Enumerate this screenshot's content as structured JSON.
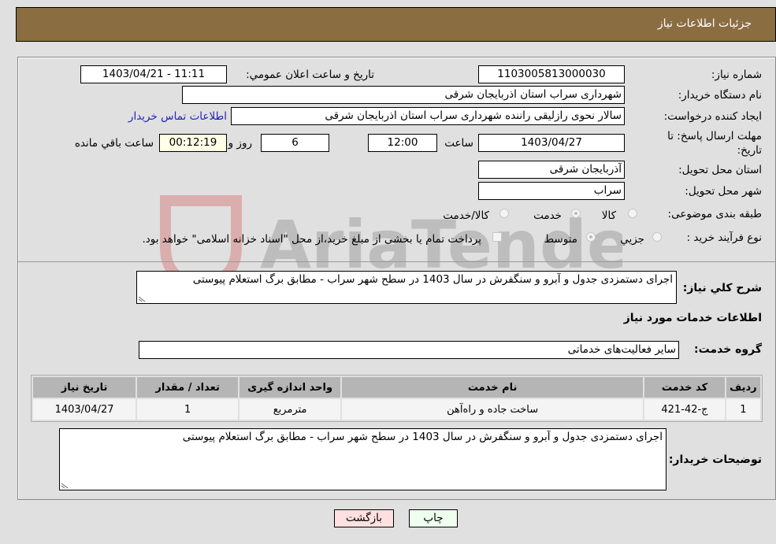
{
  "header": {
    "title": "جزئیات اطلاعات نیاز"
  },
  "form": {
    "need_number_label": "شماره نیاز:",
    "need_number": "1103005813000030",
    "announce_label": "تاریخ و ساعت اعلان عمومي:",
    "announce_value": "1403/04/21 - 11:11",
    "buyer_org_label": "نام دستگاه خریدار:",
    "buyer_org": "شهرداری سراب استان اذربایجان شرقی",
    "creator_label": "ایجاد کننده درخواست:",
    "creator": "سالار نحوی رازلیقی راننده شهرداری سراب استان اذربایجان شرقی",
    "contact_link": "اطلاعات تماس خریدار",
    "deadline_label_line1": "مهلت ارسال پاسخ: تا",
    "deadline_label_line2": "تاریخ:",
    "deadline_date": "1403/04/27",
    "time_label": "ساعت",
    "deadline_time": "12:00",
    "days": "6",
    "days_label": "روز و",
    "remaining": "00:12:19",
    "remaining_label": "ساعت باقي مانده",
    "province_label": "استان محل تحویل:",
    "province": "آذربایجان شرقی",
    "city_label": "شهر محل تحویل:",
    "city": "سراب",
    "category_label": "طبقه بندی موضوعی:",
    "category_options": [
      {
        "label": "کالا",
        "checked": false
      },
      {
        "label": "خدمت",
        "checked": true
      },
      {
        "label": "کالا/خدمت",
        "checked": false
      }
    ],
    "process_label": "نوع فرآیند خرید :",
    "process_options": [
      {
        "label": "جزيي",
        "checked": false
      },
      {
        "label": "متوسط",
        "checked": true
      }
    ],
    "payment_note": "پرداخت تمام یا بخشی از مبلغ خرید،از محل \"اسناد خزانه اسلامی\" خواهد بود.",
    "payment_checked": false
  },
  "summary": {
    "label": "شرح كلي نياز:",
    "text": "اجرای دستمزدی جدول و آبرو و سنگفرش در سال 1403 در سطح شهر سراب - مطابق برگ استعلام پیوستی"
  },
  "services": {
    "section_title": "اطلاعات خدمات مورد نیاز",
    "group_label": "گروه خدمت:",
    "group_value": "سایر فعالیت‌های خدماتی",
    "table": {
      "columns": [
        "ردیف",
        "کد خدمت",
        "نام خدمت",
        "واحد اندازه گیری",
        "تعداد / مقدار",
        "تاریخ نیاز"
      ],
      "rows": [
        [
          "1",
          "ج-42-421",
          "ساخت جاده و راه‌آهن",
          "مترمربع",
          "1",
          "1403/04/27"
        ]
      ]
    }
  },
  "buyer_notes": {
    "label": "توضیحات خریدار:",
    "text": "اجرای دستمزدی جدول و آبرو و سنگفرش در سال 1403 در سطح شهر سراب - مطابق برگ استعلام پیوستی"
  },
  "buttons": {
    "print": "چاپ",
    "back": "بازگشت"
  },
  "colors": {
    "header_bg": "#8b6d42",
    "print_bg": "#eeffee",
    "back_bg": "#ffe0e0",
    "link": "#2222bb"
  },
  "watermark": {
    "text": "AriaTender.neT"
  }
}
